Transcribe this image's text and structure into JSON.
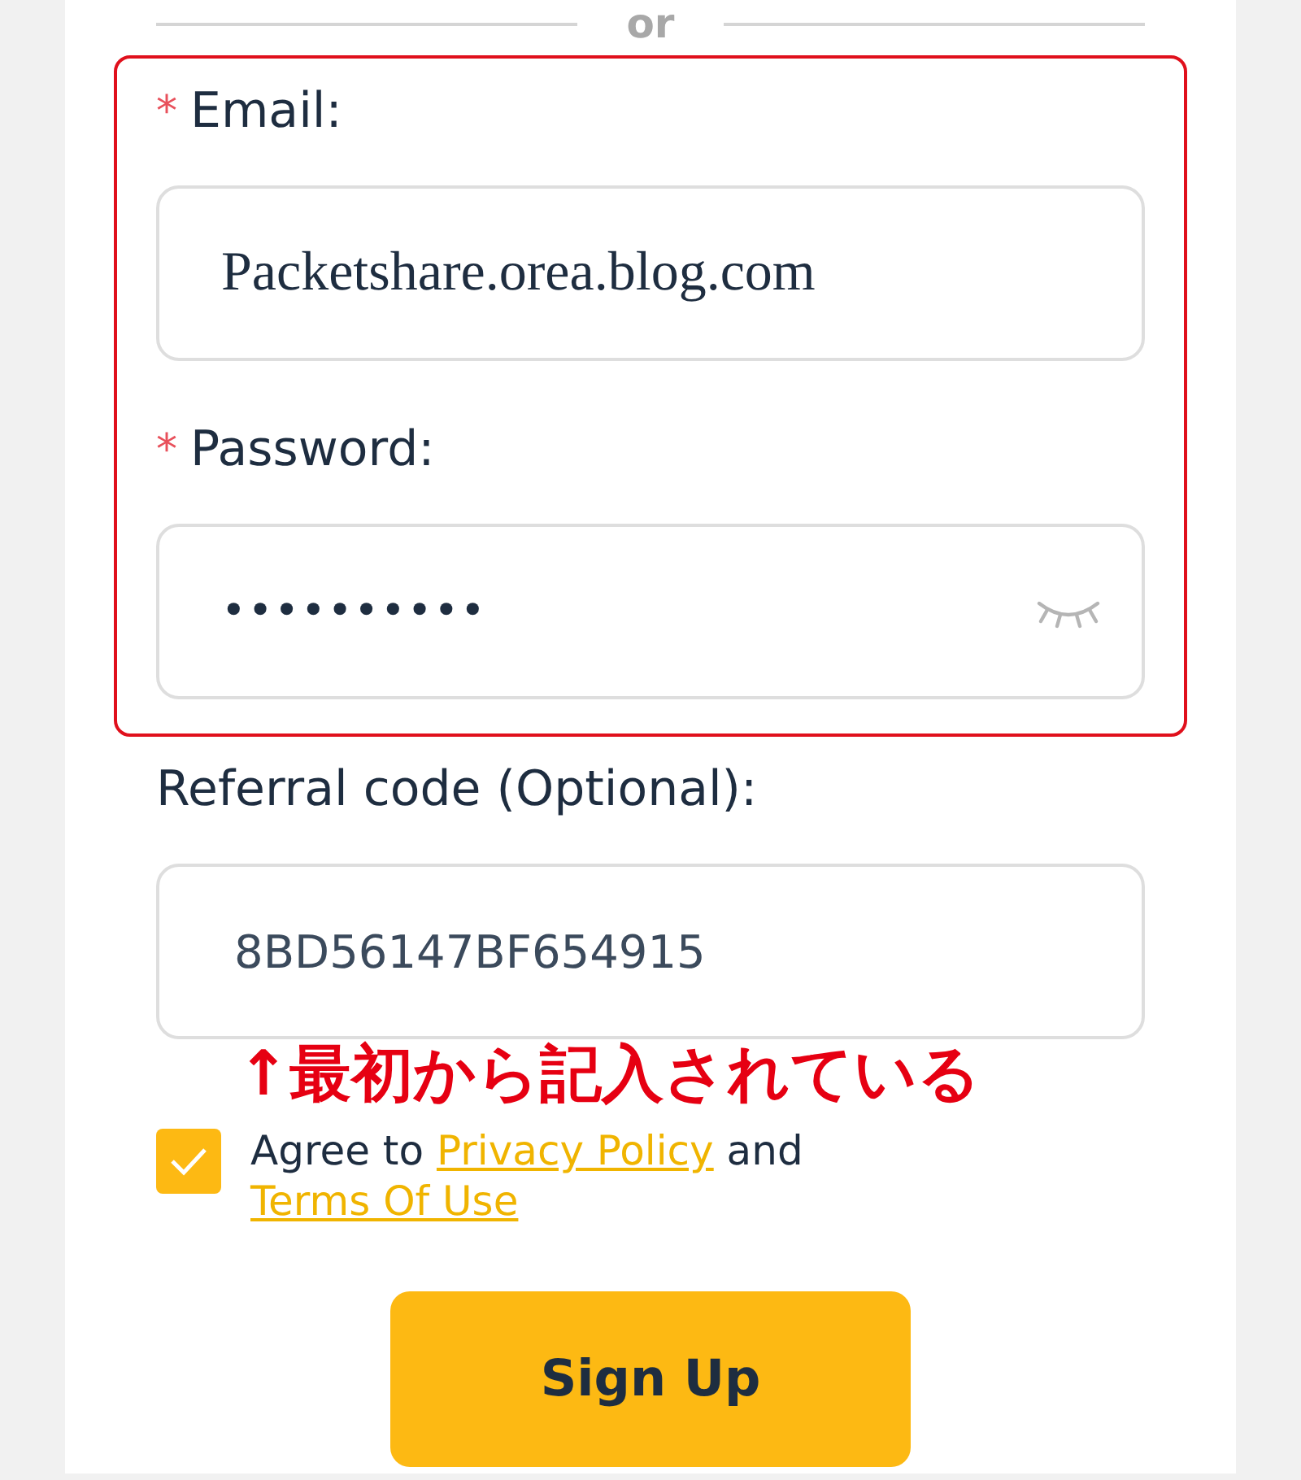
{
  "divider": {
    "text": "or"
  },
  "highlight_frame": {
    "fields": [
      {
        "required_mark": "*",
        "label": "Email:",
        "kind": "text",
        "value": "Packetshare.orea.blog.com"
      },
      {
        "required_mark": "*",
        "label": "Password:",
        "kind": "password",
        "value": "••••••••••"
      }
    ]
  },
  "fields": [
    {
      "label": "Referral code (Optional):",
      "kind": "text",
      "value": "8BD56147BF654915",
      "note": "↑最初から記入されている"
    }
  ],
  "agreement": {
    "checked": true,
    "parts": [
      {
        "kind": "text",
        "text": "Agree to"
      },
      {
        "kind": "link",
        "text": "Privacy Policy"
      },
      {
        "kind": "text",
        "text": "and"
      },
      {
        "kind": "link",
        "text": "Terms Of Use"
      }
    ]
  },
  "submit": {
    "label": "Sign Up"
  }
}
